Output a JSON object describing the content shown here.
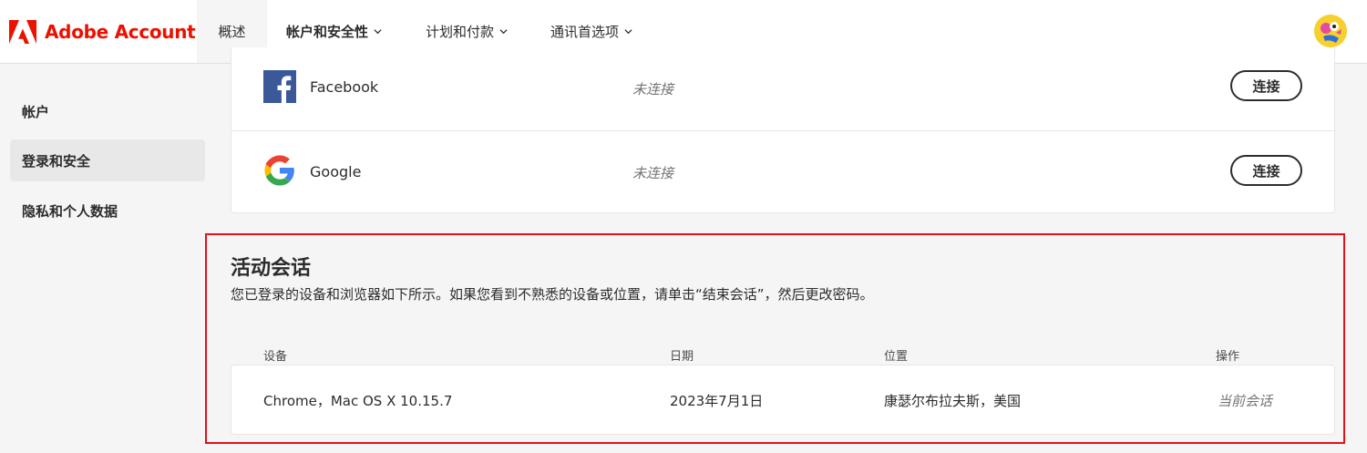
{
  "brand": {
    "name": "Adobe Account"
  },
  "nav": {
    "overview": "概述",
    "account_security": "帐户和安全性",
    "plans_payments": "计划和付款",
    "communication": "通讯首选项"
  },
  "sidebar": {
    "items": [
      {
        "label": "帐户"
      },
      {
        "label": "登录和安全"
      },
      {
        "label": "隐私和个人数据"
      }
    ]
  },
  "social": {
    "rows": [
      {
        "name": "Facebook",
        "status": "未连接",
        "button": "连接",
        "icon": "facebook-icon"
      },
      {
        "name": "Google",
        "status": "未连接",
        "button": "连接",
        "icon": "google-icon"
      }
    ]
  },
  "sessions": {
    "title": "活动会话",
    "description": "您已登录的设备和浏览器如下所示。如果您看到不熟悉的设备或位置，请单击“结束会话”，然后更改密码。",
    "columns": {
      "device": "设备",
      "date": "日期",
      "location": "位置",
      "action": "操作"
    },
    "rows": [
      {
        "device": "Chrome，Mac OS X 10.15.7",
        "date": "2023年7月1日",
        "location": "康瑟尔布拉夫斯，美国",
        "action": "当前会话"
      }
    ]
  },
  "colors": {
    "brand_red": "#eb1000",
    "highlight_border": "#e3101a",
    "facebook_blue": "#3b5998"
  }
}
